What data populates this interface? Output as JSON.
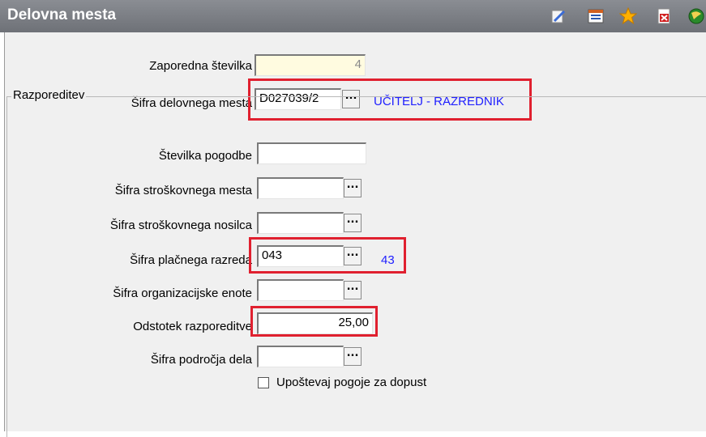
{
  "window": {
    "title": "Delovna mesta"
  },
  "toolbar": {
    "icons": [
      "edit-icon",
      "list-icon",
      "star-icon",
      "delete-icon",
      "globe-icon"
    ]
  },
  "form": {
    "zaporedna_label": "Zaporedna številka",
    "zaporedna_value": "4",
    "sifra_dm_label": "Šifra delovnega mesta",
    "sifra_dm_value": "D027039/2",
    "sifra_dm_desc": "UČITELJ - RAZREDNIK",
    "lookup_label": "...",
    "group_label": "Razporeditev",
    "stevilka_pogodbe_label": "Številka pogodbe",
    "stevilka_pogodbe_value": "",
    "sifra_sm_label": "Šifra stroškovnega mesta",
    "sifra_sm_value": "",
    "sifra_sn_label": "Šifra stroškovnega nosilca",
    "sifra_sn_value": "",
    "sifra_pr_label": "Šifra plačnega razreda",
    "sifra_pr_value": "043",
    "sifra_pr_desc": "43",
    "sifra_oe_label": "Šifra organizacijske enote",
    "sifra_oe_value": "",
    "odstotek_label": "Odstotek razporeditve",
    "odstotek_value": "25,00",
    "sifra_pd_label": "Šifra področja dela",
    "sifra_pd_value": "",
    "upostevaj_label": "Upoštevaj pogoje za dopust",
    "upostevaj_checked": false
  },
  "colors": {
    "highlight": "#e0202f",
    "desc_text": "#2020ff",
    "readonly_bg": "#fffbe0"
  }
}
